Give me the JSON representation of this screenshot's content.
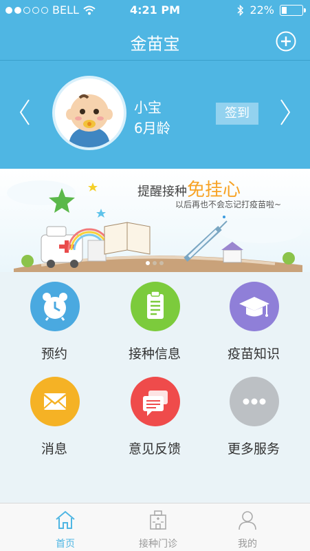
{
  "status_bar": {
    "carrier": "BELL",
    "time": "4:21 PM",
    "battery": "22%",
    "battery_level": 0.22
  },
  "nav": {
    "title": "金苗宝",
    "add_icon": "plus-circle-icon"
  },
  "profile": {
    "name": "小宝",
    "age": "6月龄",
    "checkin_label": "签到"
  },
  "banner": {
    "title_prefix": "提醒接种",
    "title_highlight": "免挂心",
    "subtitle": "以后再也不会忘记打疫苗啦~",
    "page_count": 3,
    "current_page": 1
  },
  "services": [
    {
      "label": "预约",
      "icon": "alarm-clock-icon",
      "color": "#4aa9e0"
    },
    {
      "label": "接种信息",
      "icon": "clipboard-icon",
      "color": "#7ccb3c"
    },
    {
      "label": "疫苗知识",
      "icon": "graduation-cap-icon",
      "color": "#8f7fd8"
    },
    {
      "label": "消息",
      "icon": "envelope-icon",
      "color": "#f5b225"
    },
    {
      "label": "意见反馈",
      "icon": "chat-bubbles-icon",
      "color": "#ef4b4b"
    },
    {
      "label": "更多服务",
      "icon": "more-dots-icon",
      "color": "#bcc0c4"
    }
  ],
  "tabs": [
    {
      "label": "首页",
      "icon": "home-icon",
      "active": true
    },
    {
      "label": "接种门诊",
      "icon": "hospital-icon",
      "active": false
    },
    {
      "label": "我的",
      "icon": "user-icon",
      "active": false
    }
  ],
  "colors": {
    "primary": "#4fb6e3",
    "tab_inactive": "#999999"
  }
}
